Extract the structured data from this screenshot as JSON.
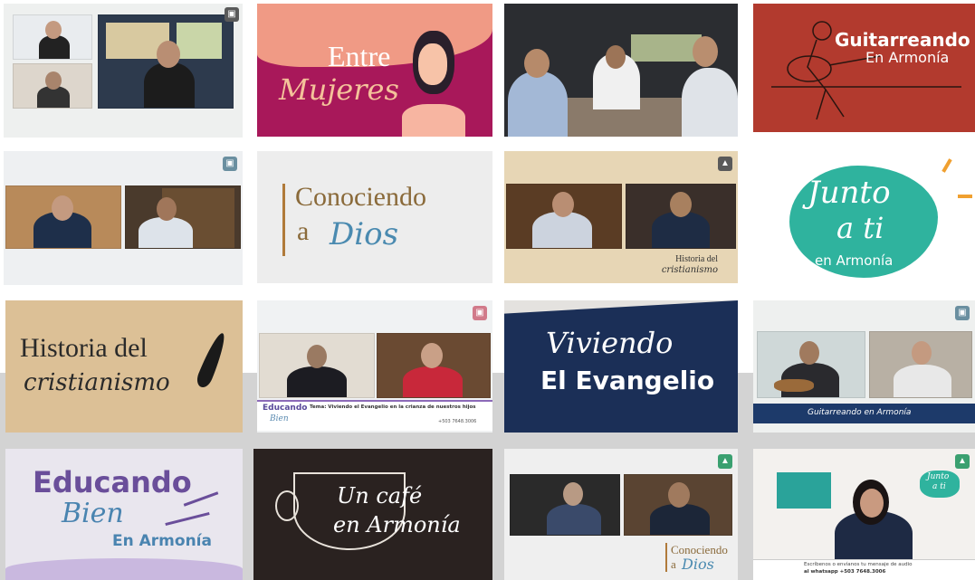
{
  "tiles": {
    "t2": {
      "line1": "Entre",
      "line2": "Mujeres"
    },
    "t4": {
      "line1": "Guitarreando",
      "line2": "En Armonía"
    },
    "t6": {
      "line1": "Conociendo",
      "line2": "a",
      "line3": "Dios"
    },
    "t7": {
      "caption1": "Historia del",
      "caption2": "cristianismo"
    },
    "t8": {
      "line1": "Junto",
      "line2": "a ti",
      "line3": "en Armonía"
    },
    "t9": {
      "line1": "Historia del",
      "line2": "cristianismo"
    },
    "t10": {
      "brand1": "Educando",
      "brand2": "Bien",
      "topic": "Tema: Viviendo el Evangelio en la crianza de nuestros hijos",
      "contact": "+503 7648.3006"
    },
    "t11": {
      "line1": "Viviendo",
      "line2": "El Evangelio"
    },
    "t12": {
      "caption": "Guitarreando en Armonía"
    },
    "t13": {
      "line1": "Educando",
      "line2": "Bien",
      "line3": "En Armonía"
    },
    "t14": {
      "line1": "Un café",
      "line2": "en Armonía"
    },
    "t15": {
      "line1": "Conociendo",
      "line2": "a",
      "line3": "Dios"
    },
    "t16": {
      "msg1": "Escríbenos o envíanos tu mensaje de audio",
      "msg2": "al whatsapp +503 7648.3006",
      "badge1": "Junto",
      "badge2": "a ti"
    }
  }
}
